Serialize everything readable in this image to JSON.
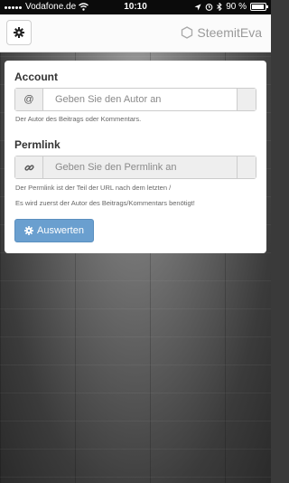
{
  "status_bar": {
    "carrier": "Vodafone.de",
    "time": "10:10",
    "battery": "90 %",
    "icons": [
      "signal-dots-icon",
      "wifi-icon",
      "location-icon",
      "alarm-icon",
      "bluetooth-icon",
      "battery-icon"
    ]
  },
  "header": {
    "settings_icon": "gear-icon",
    "brand_name": "SteemitEva",
    "brand_icon": "hexagon-logo-icon"
  },
  "form": {
    "account": {
      "label": "Account",
      "addon": "@",
      "placeholder": "Geben Sie den Autor an",
      "help": "Der Autor des Beitrags oder Kommentars."
    },
    "permlink": {
      "label": "Permlink",
      "addon_icon": "link-icon",
      "placeholder": "Geben Sie den Permlink an",
      "help_line1": "Der Permlink ist der Teil der URL nach dem letzten /",
      "help_line2": "Es wird zuerst der Autor des Beitrags/Kommentars benötigt!"
    },
    "submit": {
      "label": "Auswerten",
      "icon": "gear-icon"
    }
  },
  "colors": {
    "accent_button": "#6a9fcf",
    "header_bg": "#fbfbfb",
    "status_bar_bg": "#0b0b0b"
  }
}
